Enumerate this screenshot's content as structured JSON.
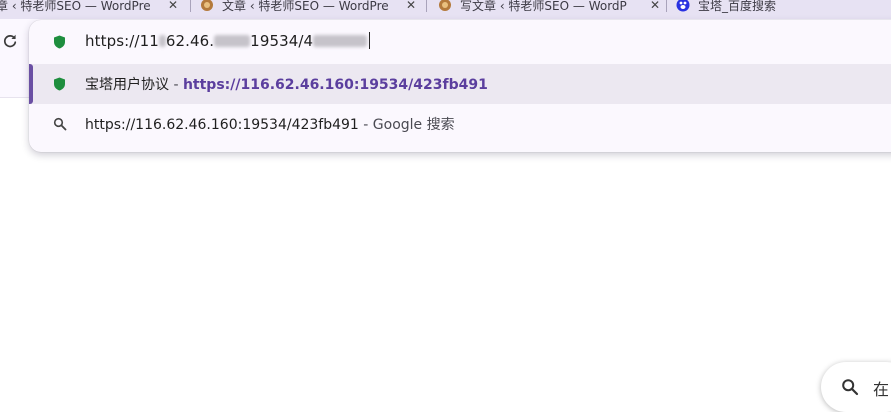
{
  "tabs": [
    {
      "label": "章 ‹ 特老师SEO — WordPre",
      "close": "✕"
    },
    {
      "label": "文章 ‹ 特老师SEO — WordPre",
      "close": "✕"
    },
    {
      "label": "写文章 ‹ 特老师SEO — WordP",
      "close": "✕"
    },
    {
      "label": "宝塔_百度搜索",
      "close": ""
    }
  ],
  "omnibox": {
    "text_start": "https://11",
    "text_mid": "62.46.",
    "text_port": "19534/4"
  },
  "suggestions": [
    {
      "title": "宝塔用户协议",
      "separator": " - ",
      "url": "https://116.62.46.160:19534/423fb491",
      "icon": "shield-icon"
    },
    {
      "text": "https://116.62.46.160:19534/423fb491",
      "suffix": " - Google 搜索",
      "icon": "search-icon"
    }
  ],
  "search_pill": {
    "label": "在",
    "icon": "search-icon"
  },
  "colors": {
    "accent": "#6a4fa3",
    "url": "#5b3e9e",
    "shield": "#1e8e3e"
  }
}
